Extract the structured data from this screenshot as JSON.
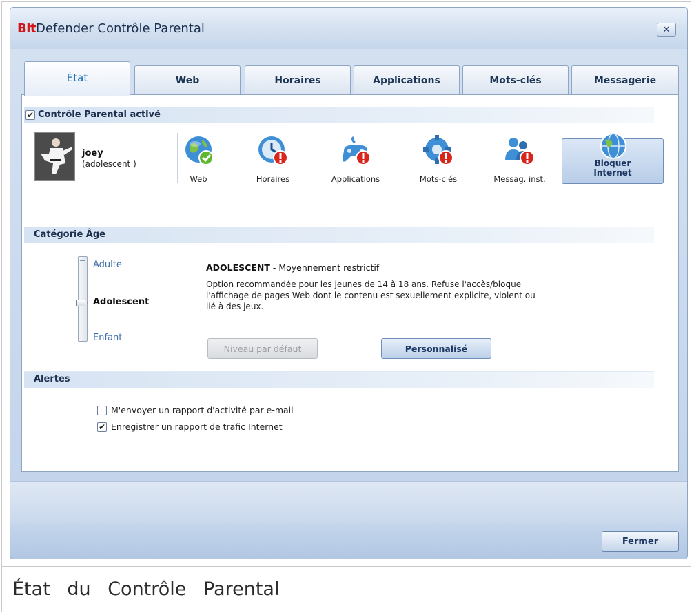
{
  "window": {
    "title_brand": "Bit",
    "title_rest": "Defender Contrôle Parental",
    "close_glyph": "✕"
  },
  "tabs": [
    {
      "label": "État",
      "active": true
    },
    {
      "label": "Web"
    },
    {
      "label": "Horaires"
    },
    {
      "label": "Applications"
    },
    {
      "label": "Mots-clés"
    },
    {
      "label": "Messagerie"
    }
  ],
  "control": {
    "label": "Contrôle Parental activé",
    "checked": "✔"
  },
  "user": {
    "name": "joey",
    "role": "(adolescent )"
  },
  "features": [
    {
      "label": "Web",
      "icon": "globe-check-icon"
    },
    {
      "label": "Horaires",
      "icon": "clock-warning-icon"
    },
    {
      "label": "Applications",
      "icon": "gamepad-warning-icon"
    },
    {
      "label": "Mots-clés",
      "icon": "gear-warning-icon"
    },
    {
      "label": "Messag. inst.",
      "icon": "users-warning-icon"
    }
  ],
  "block_internet": {
    "line1": "Bloquer",
    "line2": "Internet",
    "icon": "globe-icon"
  },
  "age": {
    "section_label": "Catégorie Âge",
    "levels": {
      "adult": "Adulte",
      "teen": "Adolescent",
      "child": "Enfant"
    },
    "selected": "Adolescent",
    "desc_title_bold": "ADOLESCENT",
    "desc_title_rest": " - Moyennement restrictif",
    "desc_body": "Option recommandée pour les jeunes de 14 à 18 ans. Refuse l'accès/bloque l'affichage de pages Web dont le contenu est sexuellement explicite, violent ou lié à des jeux.",
    "default_button": "Niveau par défaut",
    "custom_button": "Personnalisé"
  },
  "alerts": {
    "section_label": "Alertes",
    "email_report": "M'envoyer un rapport d'activité par e-mail",
    "email_checked": "",
    "traffic_report": "Enregistrer un rapport de trafic Internet",
    "traffic_checked": "✔"
  },
  "footer": {
    "close_button": "Fermer"
  },
  "caption": "État du Contrôle Parental",
  "colors": {
    "brand_red": "#d01616",
    "accent_blue": "#1e6fb3",
    "warning_red": "#d9261c",
    "check_green": "#5db82f"
  }
}
